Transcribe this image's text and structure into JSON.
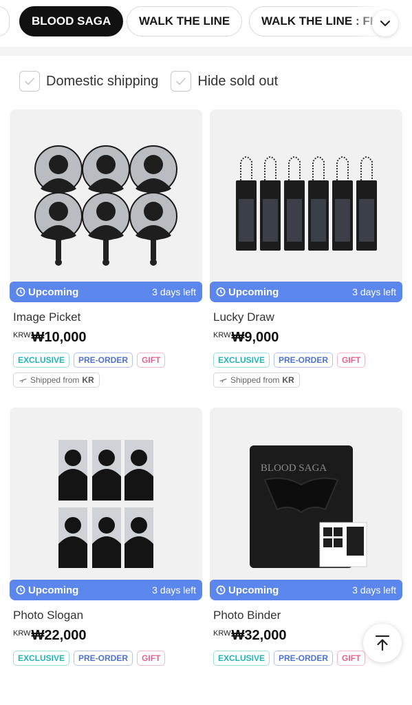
{
  "categories": {
    "items": [
      {
        "label": "BLOOD SAGA",
        "active": true
      },
      {
        "label": "WALK THE LINE",
        "active": false
      },
      {
        "label": "WALK THE LINE : FI",
        "active": false
      }
    ],
    "expand_icon": "chevron-down-icon"
  },
  "filters": [
    {
      "label": "Domestic shipping",
      "checked": false
    },
    {
      "label": "Hide sold out",
      "checked": false
    }
  ],
  "products": [
    {
      "name": "Image Picket",
      "currency": "KRW",
      "price": "₩10,000",
      "status": "Upcoming",
      "time_left": "3 days left",
      "tags": [
        "EXCLUSIVE",
        "PRE-ORDER",
        "GIFT"
      ],
      "shipping": {
        "prefix": "Shipped from",
        "country": "KR"
      }
    },
    {
      "name": "Lucky Draw",
      "currency": "KRW",
      "price": "₩9,000",
      "status": "Upcoming",
      "time_left": "3 days left",
      "tags": [
        "EXCLUSIVE",
        "PRE-ORDER",
        "GIFT"
      ],
      "shipping": {
        "prefix": "Shipped from",
        "country": "KR"
      }
    },
    {
      "name": "Photo Slogan",
      "currency": "KRW",
      "price": "₩22,000",
      "status": "Upcoming",
      "time_left": "3 days left",
      "tags": [
        "EXCLUSIVE",
        "PRE-ORDER",
        "GIFT"
      ]
    },
    {
      "name": "Photo Binder",
      "currency": "KRW",
      "price": "₩32,000",
      "status": "Upcoming",
      "time_left": "3 days left",
      "tags": [
        "EXCLUSIVE",
        "PRE-ORDER",
        "GIFT"
      ],
      "cover_text": "BLOOD SAGA"
    }
  ],
  "colors": {
    "status_bar": "#5b86ec",
    "exclusive": "#22b3b5",
    "preorder": "#4f73c9",
    "gift": "#e0638d"
  }
}
